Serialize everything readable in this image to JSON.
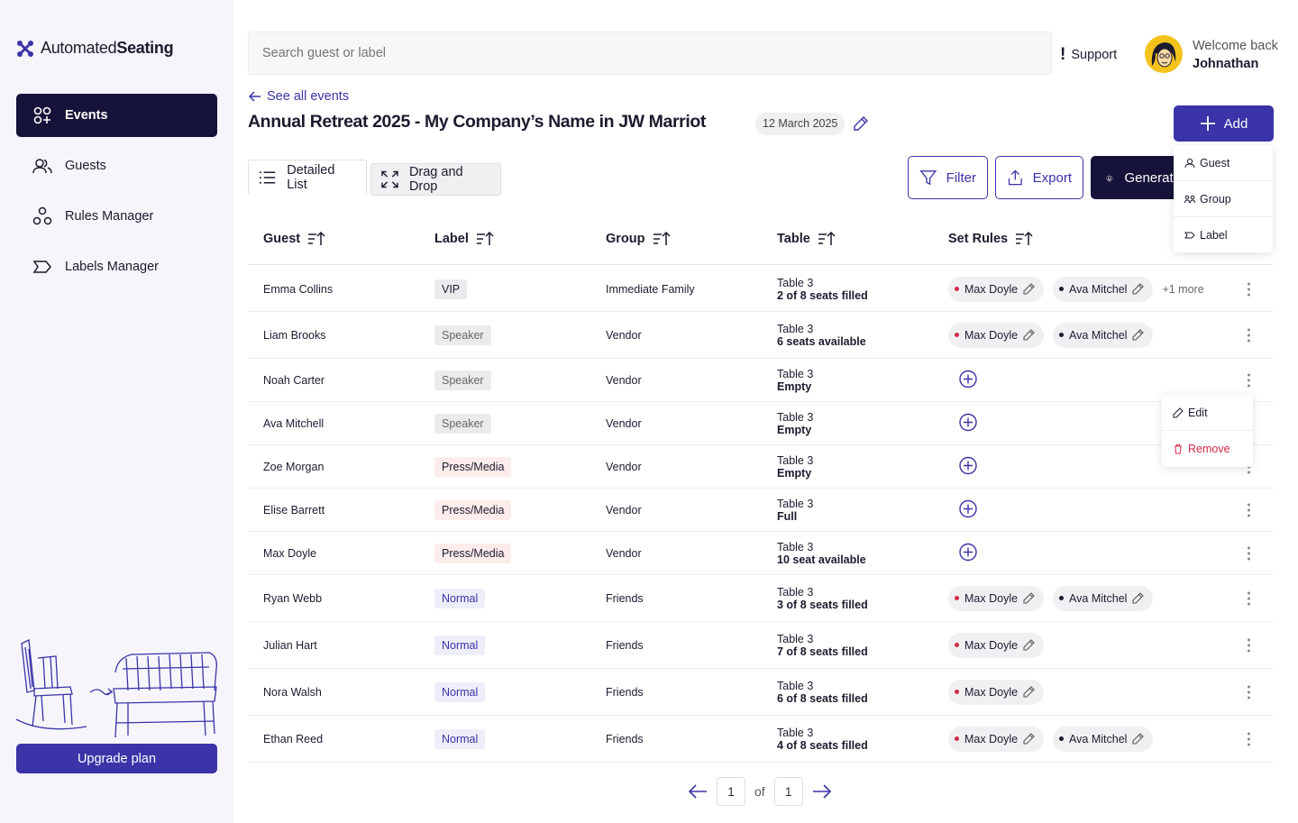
{
  "app": {
    "logo_light": "Automated",
    "logo_bold": "Seating"
  },
  "sidebar": {
    "items": [
      {
        "label": "Events",
        "icon": "events-icon",
        "active": true
      },
      {
        "label": "Guests",
        "icon": "guests-icon"
      },
      {
        "label": "Rules Manager",
        "icon": "rules-icon"
      },
      {
        "label": "Labels Manager",
        "icon": "labels-icon"
      }
    ],
    "upgrade_label": "Upgrade plan"
  },
  "header": {
    "search_placeholder": "Search guest or label",
    "support_mark": "!",
    "support_label": "Support",
    "welcome_text": "Welcome back",
    "user_name": "Johnathan"
  },
  "event": {
    "back_label": "See all events",
    "title": "Annual Retreat 2025 - My Company’s Name in JW Marriot",
    "date": "12 March 2025",
    "add_label": "Add"
  },
  "add_menu": [
    "Guest",
    "Group",
    "Label"
  ],
  "row_menu": {
    "edit": "Edit",
    "remove": "Remove"
  },
  "tabs": {
    "detailed": "Detailed List",
    "drag": "Drag and Drop"
  },
  "toolbar": {
    "filter": "Filter",
    "export": "Export",
    "generate": "Generate"
  },
  "table": {
    "headers": {
      "guest": "Guest",
      "label": "Label",
      "group": "Group",
      "table": "Table",
      "rules": "Set Rules"
    },
    "rows": [
      {
        "guest": "Emma Collins",
        "label": "VIP",
        "label_type": "vip",
        "group": "Immediate Family",
        "table": "Table 3",
        "seats": "2 of 8 seats filled",
        "rules": [
          "Max Doyle",
          "Ava Mitchel"
        ],
        "more": "+1 more"
      },
      {
        "guest": "Liam Brooks",
        "label": "Speaker",
        "label_type": "speaker",
        "group": "Vendor",
        "table": "Table 3",
        "seats": "6 seats available",
        "rules": [
          "Max Doyle",
          "Ava Mitchel"
        ]
      },
      {
        "guest": "Noah Carter",
        "label": "Speaker",
        "label_type": "speaker",
        "group": "Vendor",
        "table": "Table 3",
        "seats": "Empty",
        "rules": []
      },
      {
        "guest": "Ava Mitchell",
        "label": "Speaker",
        "label_type": "speaker",
        "group": "Vendor",
        "table": "Table 3",
        "seats": "Empty",
        "rules": []
      },
      {
        "guest": "Zoe Morgan",
        "label": "Press/Media",
        "label_type": "press",
        "group": "Vendor",
        "table": "Table 3",
        "seats": "Empty",
        "rules": []
      },
      {
        "guest": "Elise Barrett",
        "label": "Press/Media",
        "label_type": "press",
        "group": "Vendor",
        "table": "Table 3",
        "seats": "Full",
        "rules": []
      },
      {
        "guest": "Max Doyle",
        "label": "Press/Media",
        "label_type": "press",
        "group": "Vendor",
        "table": "Table 3",
        "seats": "10 seat available",
        "rules": []
      },
      {
        "guest": "Ryan Webb",
        "label": "Normal",
        "label_type": "normal",
        "group": "Friends",
        "table": "Table 3",
        "seats": "3 of 8 seats filled",
        "rules": [
          "Max Doyle",
          "Ava Mitchel"
        ]
      },
      {
        "guest": "Julian Hart",
        "label": "Normal",
        "label_type": "normal",
        "group": "Friends",
        "table": "Table 3",
        "seats": "7 of 8 seats filled",
        "rules": [
          "Max Doyle"
        ]
      },
      {
        "guest": "Nora Walsh",
        "label": "Normal",
        "label_type": "normal",
        "group": "Friends",
        "table": "Table 3",
        "seats": "6 of 8 seats filled",
        "rules": [
          "Max Doyle"
        ]
      },
      {
        "guest": "Ethan Reed",
        "label": "Normal",
        "label_type": "normal",
        "group": "Friends",
        "table": "Table 3",
        "seats": "4 of 8 seats filled",
        "rules": [
          "Max Doyle",
          "Ava Mitchel"
        ]
      }
    ]
  },
  "pagination": {
    "current": "1",
    "of_label": "of",
    "total": "1"
  },
  "colors": {
    "accent": "#3a34a8",
    "dark": "#16133a",
    "rule_dot_first": "#d22a4a",
    "rule_dot_second": "#1c1b2e"
  }
}
